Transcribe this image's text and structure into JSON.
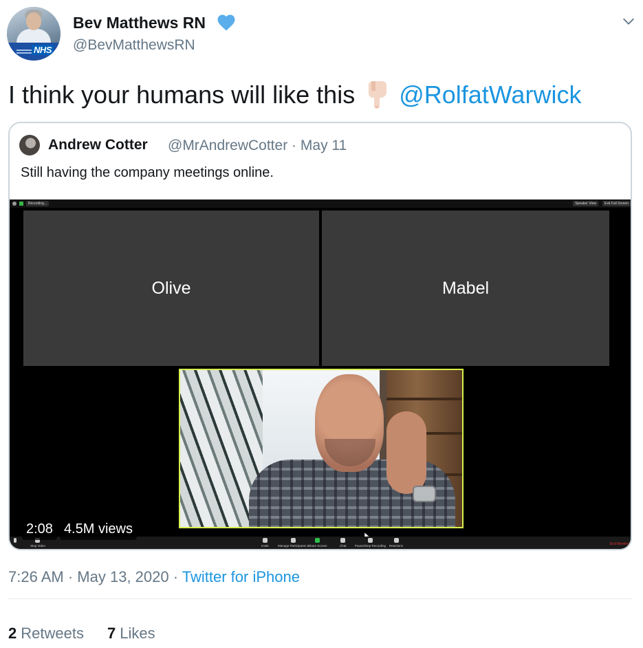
{
  "author": {
    "display_name": "Bev Matthews RN",
    "handle": "@BevMatthewsRN",
    "avatar_badge": "NHS"
  },
  "tweet": {
    "text": "I think your humans will like this",
    "emoji": "pointing-down-finger",
    "mention": "@RolfatWarwick"
  },
  "quoted": {
    "name": "Andrew Cotter",
    "handle": "@MrAndrewCotter",
    "date": "May 11",
    "text": "Still having the company meetings online.",
    "video": {
      "duration": "2:08",
      "views": "4.5M views",
      "zoom_top_left": "Recording...",
      "zoom_top_right": [
        "Speaker View",
        "Exit Full Screen"
      ],
      "participants": [
        "Olive",
        "Mabel"
      ],
      "toolbar": [
        "Stop Video",
        "Invite",
        "Manage Participants",
        "Share Screen",
        "Chat",
        "Pause/Stop Recording",
        "Reactions"
      ],
      "participant_count": "3",
      "end_meeting": "End Meeting"
    }
  },
  "meta": {
    "time": "7:26 AM",
    "date": "May 13, 2020",
    "separator": "·",
    "source": "Twitter for iPhone"
  },
  "stats": {
    "retweets_count": "2",
    "retweets_label": "Retweets",
    "likes_count": "7",
    "likes_label": "Likes"
  },
  "colors": {
    "link": "#1b95e0",
    "muted": "#657786",
    "verified": "#1da1f2",
    "active_speaker_border": "#d7f04a"
  }
}
